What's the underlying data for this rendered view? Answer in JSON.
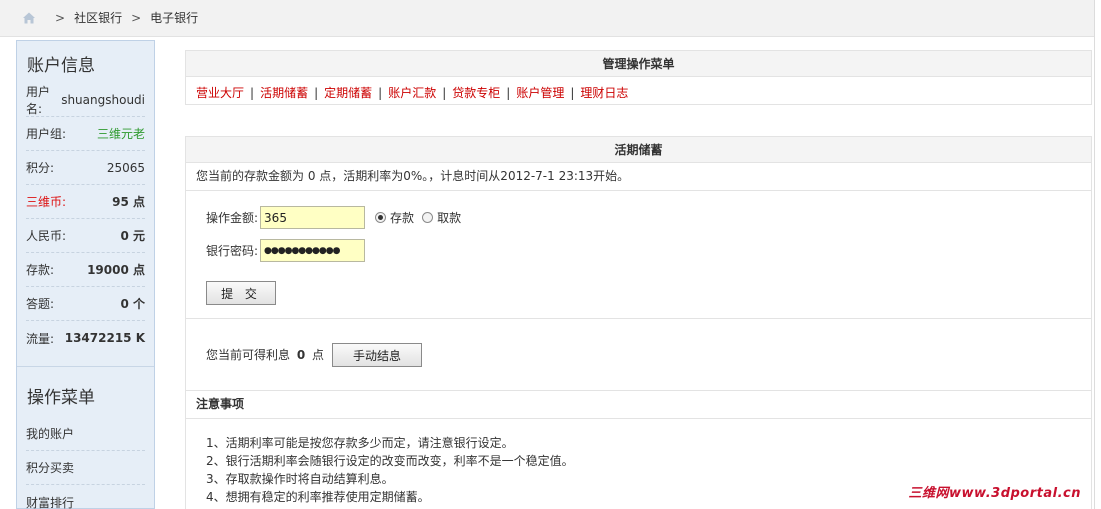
{
  "breadcrumb": {
    "items": [
      "社区银行",
      "电子银行"
    ],
    "separator": ">"
  },
  "sidebar": {
    "title": "账户信息",
    "info": [
      {
        "label": "用户名:",
        "value": "shuangshoudi"
      },
      {
        "label": "用户组:",
        "value": "三维元老"
      },
      {
        "label": "积分:",
        "value": "25065"
      },
      {
        "label": "三维币:",
        "value": "95 点"
      },
      {
        "label": "人民币:",
        "value": "0 元"
      },
      {
        "label": "存款:",
        "value": "19000 点"
      },
      {
        "label": "答题:",
        "value": "0 个"
      },
      {
        "label": "流量:",
        "value": "13472215 K"
      }
    ],
    "menu_title": "操作菜单",
    "menu": [
      "我的账户",
      "积分买卖",
      "财富排行"
    ]
  },
  "ops_menu": {
    "title": "管理操作菜单",
    "links": [
      "营业大厅",
      "活期储蓄",
      "定期储蓄",
      "账户汇款",
      "贷款专柜",
      "账户管理",
      "理财日志"
    ],
    "separator": "|"
  },
  "savings": {
    "title": "活期储蓄",
    "notice": "您当前的存款金额为 0 点，活期利率为0%。，计息时间从2012-7-1 23:13开始。",
    "amount_label": "操作金额:",
    "amount_value": "365",
    "radio_deposit": "存款",
    "radio_withdraw": "取款",
    "password_label": "银行密码:",
    "password_value": "●●●●●●●●●●●",
    "submit_label": "提 交",
    "interest_prefix": "您当前可得利息",
    "interest_value": "0",
    "interest_unit": "点",
    "settle_label": "手动结息",
    "notes_title": "注意事项",
    "notes": [
      "1、活期利率可能是按您存款多少而定，请注意银行设定。",
      "2、银行活期利率会随银行设定的改变而改变，利率不是一个稳定值。",
      "3、存取款操作时将自动结算利息。",
      "4、想拥有稳定的利率推荐使用定期储蓄。"
    ]
  },
  "watermark": "三维网www.3dportal.cn",
  "colors": {
    "accent_red": "#cc0000",
    "sidebar_bg": "#e6eef7",
    "input_bg": "#ffffc4",
    "group_green": "#2f9a2f"
  }
}
